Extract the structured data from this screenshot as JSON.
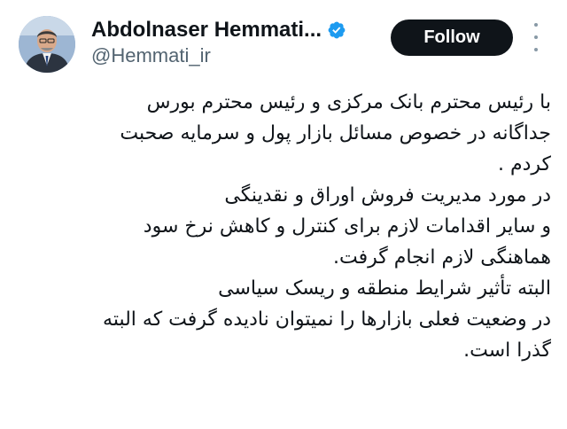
{
  "header": {
    "display_name": "Abdolnaser Hemmati...",
    "handle": "@Hemmati_ir",
    "follow_label": "Follow",
    "verified_color": "#1d9bf0"
  },
  "icons": {
    "verified": "verified-badge-icon",
    "more": "more-options-icon"
  },
  "tweet": {
    "lines": [
      "با رئیس محترم بانک مرکزی و رئیس محترم بورس",
      "جداگانه در خصوص مسائل بازار پول و سرمایه صحبت",
      "کردم .",
      "در مورد مدیریت فروش اوراق و نقدینگی",
      "و سایر اقدامات لازم برای کنترل و کاهش نرخ سود",
      "هماهنگی لازم انجام گرفت.",
      "البته تأثیر شرایط منطقه و ریسک سیاسی",
      "در وضعیت فعلی بازارها را نمیتوان نادیده گرفت که البته",
      "گذرا است."
    ]
  }
}
